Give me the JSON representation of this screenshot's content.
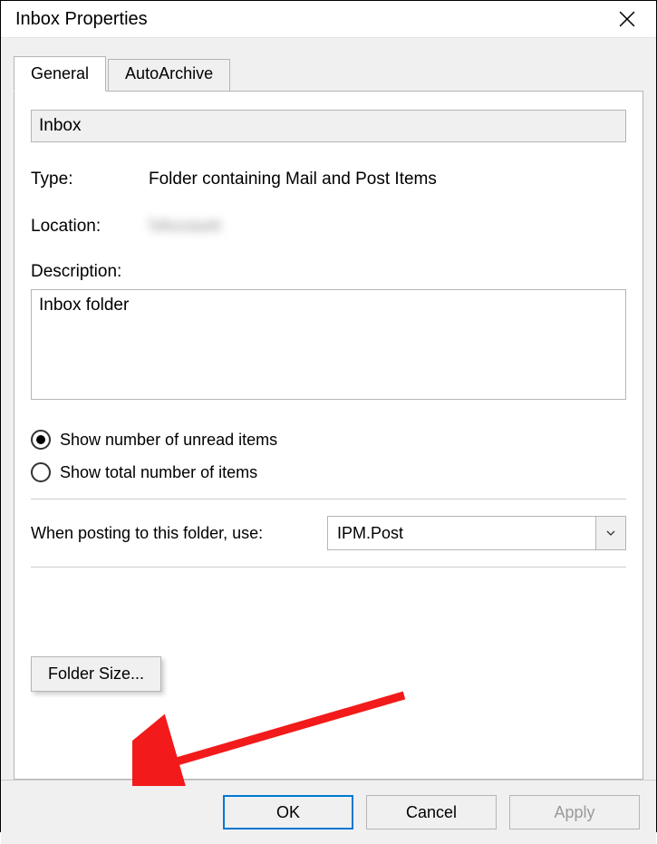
{
  "window": {
    "title": "Inbox Properties"
  },
  "tabs": {
    "general": "General",
    "autoarchive": "AutoArchive"
  },
  "general": {
    "folder_name": "Inbox",
    "type_label": "Type:",
    "type_value": "Folder containing Mail and Post Items",
    "location_label": "Location:",
    "location_value": "\\\\Account",
    "description_label": "Description:",
    "description_value": "Inbox folder",
    "radio_unread": "Show number of unread items",
    "radio_total": "Show total number of items",
    "posting_label": "When posting to this folder, use:",
    "posting_value": "IPM.Post",
    "folder_size_btn": "Folder Size..."
  },
  "buttons": {
    "ok": "OK",
    "cancel": "Cancel",
    "apply": "Apply"
  }
}
